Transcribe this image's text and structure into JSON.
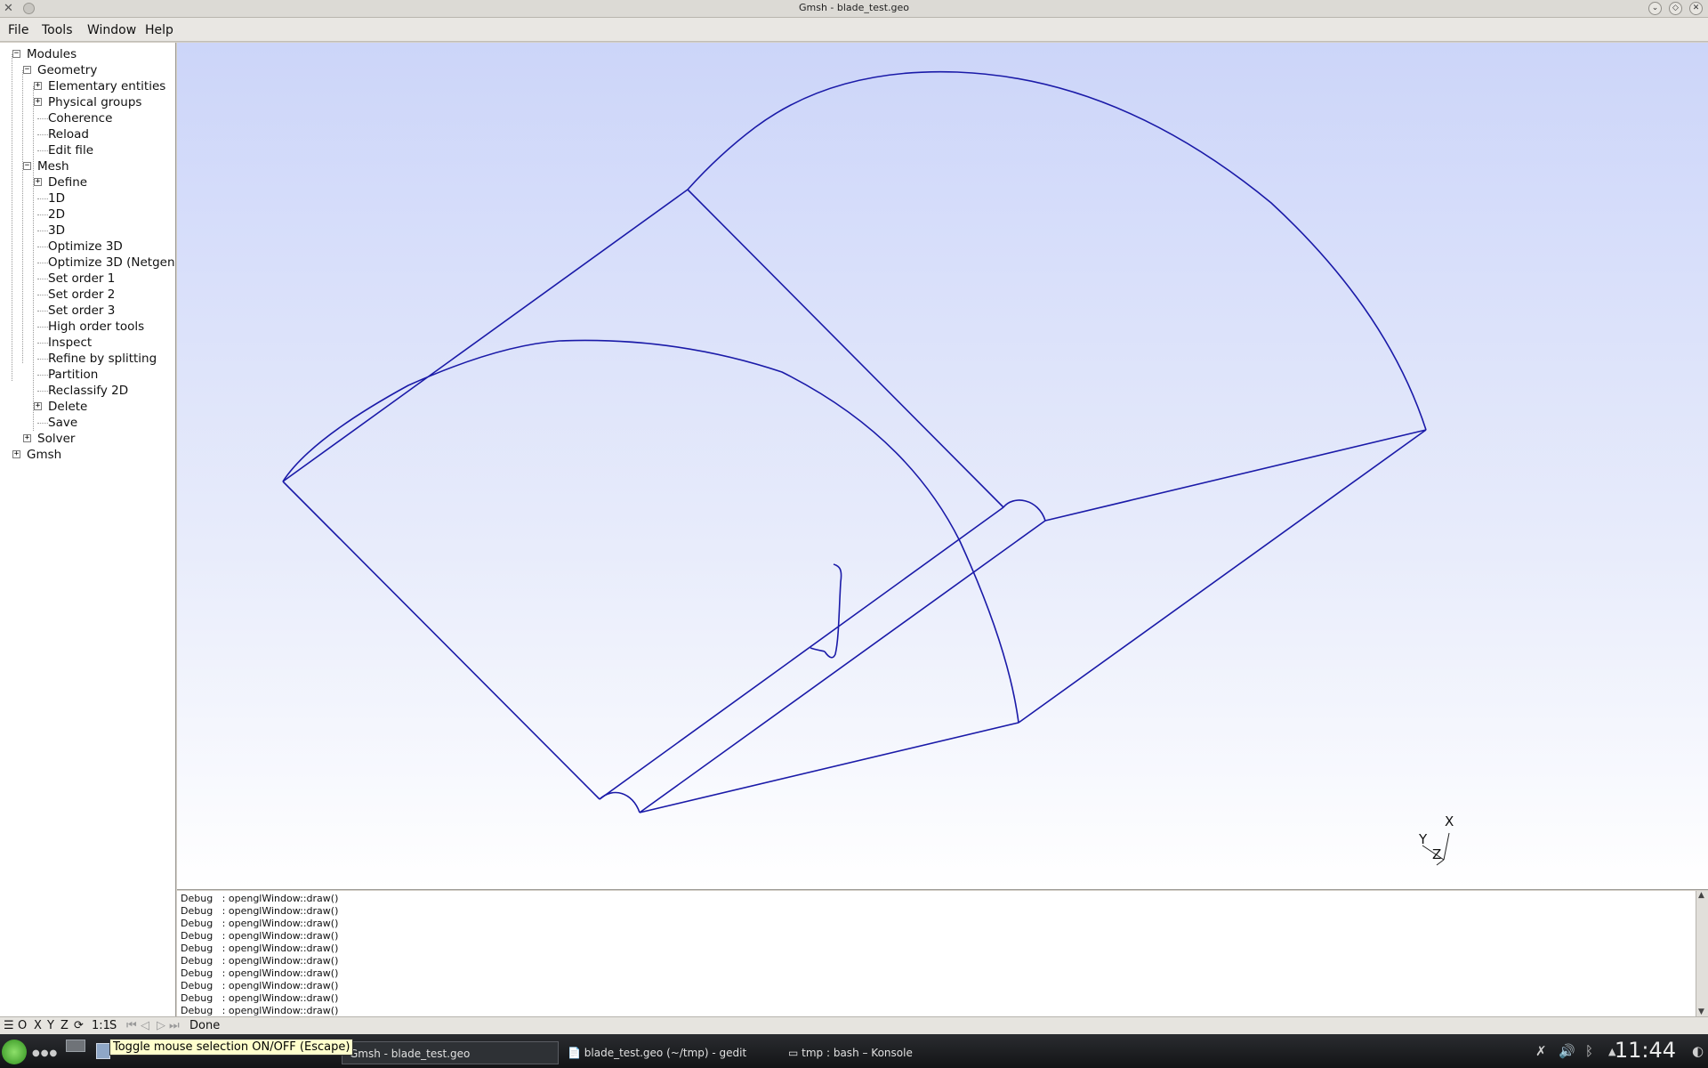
{
  "window": {
    "title": "Gmsh - blade_test.geo"
  },
  "menu": {
    "items": [
      "File",
      "Tools",
      "Window",
      "Help"
    ]
  },
  "tree": {
    "root": "Modules",
    "geometry": {
      "label": "Geometry",
      "items": [
        "Elementary entities",
        "Physical groups",
        "Coherence",
        "Reload",
        "Edit file"
      ]
    },
    "mesh": {
      "label": "Mesh",
      "items": [
        "Define",
        "1D",
        "2D",
        "3D",
        "Optimize 3D",
        "Optimize 3D (Netgen",
        "Set order 1",
        "Set order 2",
        "Set order 3",
        "High order tools",
        "Inspect",
        "Refine by splitting",
        "Partition",
        "Reclassify 2D",
        "Delete",
        "Save"
      ]
    },
    "solver": "Solver",
    "gmsh": "Gmsh"
  },
  "axes": {
    "x": "X",
    "y": "Y",
    "z": "Z"
  },
  "console": {
    "lines": [
      "Debug   : openglWindow::draw()",
      "Debug   : openglWindow::draw()",
      "Debug   : openglWindow::draw()",
      "Debug   : openglWindow::draw()",
      "Debug   : openglWindow::draw()",
      "Debug   : openglWindow::draw()",
      "Debug   : openglWindow::draw()",
      "Debug   : openglWindow::draw()",
      "Debug   : openglWindow::draw()",
      "Debug   : openglWindow::draw()"
    ]
  },
  "status": {
    "buttons": [
      "O",
      "X",
      "Y",
      "Z"
    ],
    "scale": "1:1",
    "s": "S",
    "message": "Done"
  },
  "tooltip": "Toggle mouse selection ON/OFF (Escape)",
  "taskbar": {
    "tasks": [
      "Gmsh - blade_test.geo",
      "blade_test.geo (~/tmp) - gedit",
      "tmp : bash – Konsole"
    ],
    "clock": "11:44"
  },
  "colors": {
    "geometry_line": "#1a1aa8",
    "viewport_top": "#ccd5f9",
    "viewport_bottom": "#ffffff"
  },
  "icons": [
    "gear-icon",
    "play-icon",
    "rotate-icon",
    "tree-toggle-icon"
  ]
}
